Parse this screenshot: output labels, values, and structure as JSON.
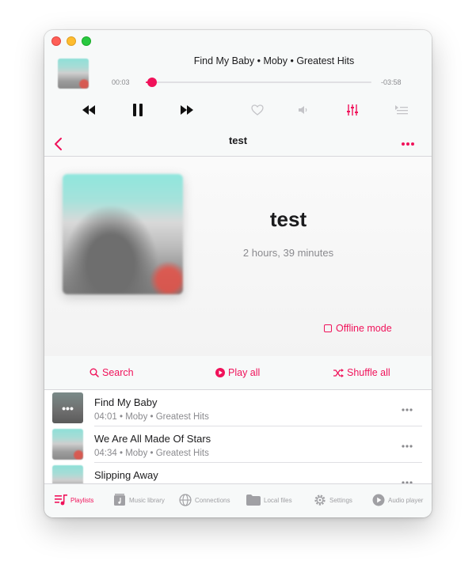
{
  "colors": {
    "accent": "#f0125a",
    "secondary_text": "#8a8a8e",
    "icon_gray": "#a0a0a4"
  },
  "now_playing": {
    "title": "Find My Baby • Moby • Greatest Hits",
    "elapsed": "00:03",
    "remaining": "-03:58",
    "progress_fraction": 0.017
  },
  "controls": {
    "icons": [
      "rewind-icon",
      "pause-icon",
      "fast-forward-icon",
      "heart-icon",
      "volume-icon",
      "equalizer-icon",
      "queue-icon"
    ]
  },
  "nav": {
    "title": "test",
    "back_icon": "chevron-left-icon",
    "more_icon": "ellipsis-icon"
  },
  "playlist": {
    "title": "test",
    "duration": "2 hours, 39 minutes",
    "offline_label": "Offline mode"
  },
  "actions": {
    "search": "Search",
    "play_all": "Play all",
    "shuffle_all": "Shuffle all"
  },
  "tracks": [
    {
      "title": "Find My Baby",
      "meta": "04:01 • Moby • Greatest Hits",
      "playing": true,
      "playing_indicator": "•••"
    },
    {
      "title": "We Are All Made Of Stars",
      "meta": "04:34 • Moby • Greatest Hits",
      "playing": false
    },
    {
      "title": "Slipping Away",
      "meta": "",
      "playing": false
    }
  ],
  "tabs": [
    {
      "label": "Playlists",
      "icon": "playlists-icon",
      "active": true
    },
    {
      "label": "Music library",
      "icon": "music-library-icon",
      "active": false
    },
    {
      "label": "Connections",
      "icon": "globe-icon",
      "active": false
    },
    {
      "label": "Local files",
      "icon": "folder-icon",
      "active": false
    },
    {
      "label": "Settings",
      "icon": "gear-icon",
      "active": false
    },
    {
      "label": "Audio player",
      "icon": "play-circle-icon",
      "active": false
    }
  ]
}
